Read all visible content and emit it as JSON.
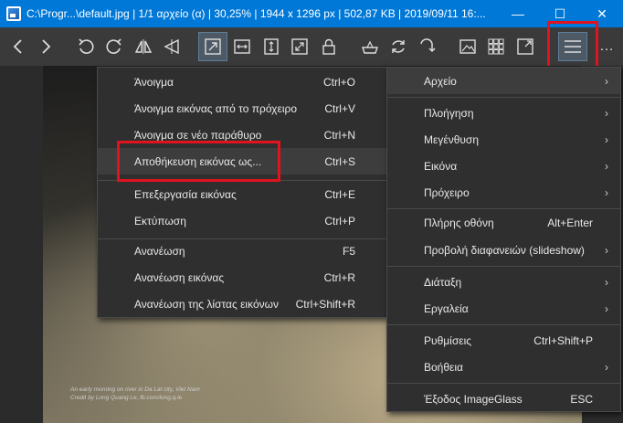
{
  "titlebar": {
    "title": "C:\\Progr...\\default.jpg  |  1/1 αρχείο (α)  |  30,25%  |  1944 x 1296 px  |  502,87 KB  |  2019/09/11 16:...",
    "minimize": "—",
    "maximize": "☐",
    "close": "✕"
  },
  "toolbar": {
    "icons": [
      "chevron-left-icon",
      "chevron-right-icon",
      "rotate-left-icon",
      "rotate-right-icon",
      "flip-horizontal-icon",
      "flip-vertical-icon",
      "auto-zoom-icon",
      "scale-to-width-icon",
      "scale-to-height-icon",
      "scale-to-fit-icon",
      "lock-zoom-icon",
      "edit-icon",
      "refresh-icon",
      "goto-icon",
      "thumbnail-icon",
      "checkerboard-icon",
      "fullscreen-icon",
      "hamburger-menu-icon",
      "more-icon"
    ],
    "more_label": "…"
  },
  "image": {
    "caption_line1": "An early morning on river in Da Lat city, Viet Nam",
    "caption_line2": "Credit by Long Quang Le, fb.com/long.q.le"
  },
  "menu_left": {
    "items": [
      {
        "label": "Άνοιγμα",
        "shortcut": "Ctrl+O"
      },
      {
        "label": "Άνοιγμα εικόνας από το πρόχειρο",
        "shortcut": "Ctrl+V"
      },
      {
        "label": "Άνοιγμα σε νέο παράθυρο",
        "shortcut": "Ctrl+N"
      },
      {
        "label": "Αποθήκευση εικόνας ως...",
        "shortcut": "Ctrl+S"
      },
      {
        "label": "Επεξεργασία εικόνας",
        "shortcut": "Ctrl+E"
      },
      {
        "label": "Εκτύπωση",
        "shortcut": "Ctrl+P"
      },
      {
        "label": "Ανανέωση",
        "shortcut": "F5"
      },
      {
        "label": "Ανανέωση εικόνας",
        "shortcut": "Ctrl+R"
      },
      {
        "label": "Ανανέωση της λίστας εικόνων",
        "shortcut": "Ctrl+Shift+R"
      }
    ]
  },
  "menu_right": {
    "items": [
      {
        "label": "Αρχείο",
        "shortcut": "",
        "submenu": "›"
      },
      {
        "label": "Πλοήγηση",
        "shortcut": "",
        "submenu": "›"
      },
      {
        "label": "Μεγένθυση",
        "shortcut": "",
        "submenu": "›"
      },
      {
        "label": "Εικόνα",
        "shortcut": "",
        "submenu": "›"
      },
      {
        "label": "Πρόχειρο",
        "shortcut": "",
        "submenu": "›"
      },
      {
        "label": "Πλήρης οθόνη",
        "shortcut": "Alt+Enter",
        "submenu": ""
      },
      {
        "label": "Προβολή διαφανειών (slideshow)",
        "shortcut": "",
        "submenu": "›"
      },
      {
        "label": "Διάταξη",
        "shortcut": "",
        "submenu": "›"
      },
      {
        "label": "Εργαλεία",
        "shortcut": "",
        "submenu": "›"
      },
      {
        "label": "Ρυθμίσεις",
        "shortcut": "Ctrl+Shift+P",
        "submenu": ""
      },
      {
        "label": "Βοήθεια",
        "shortcut": "",
        "submenu": "›"
      },
      {
        "label": "Έξοδος ImageGlass",
        "shortcut": "ESC",
        "submenu": ""
      }
    ]
  },
  "colors": {
    "titlebar": "#0078d7",
    "toolbar": "#3a3a3a",
    "menu_bg": "#2f2f2f",
    "highlight": "#e0141e"
  }
}
